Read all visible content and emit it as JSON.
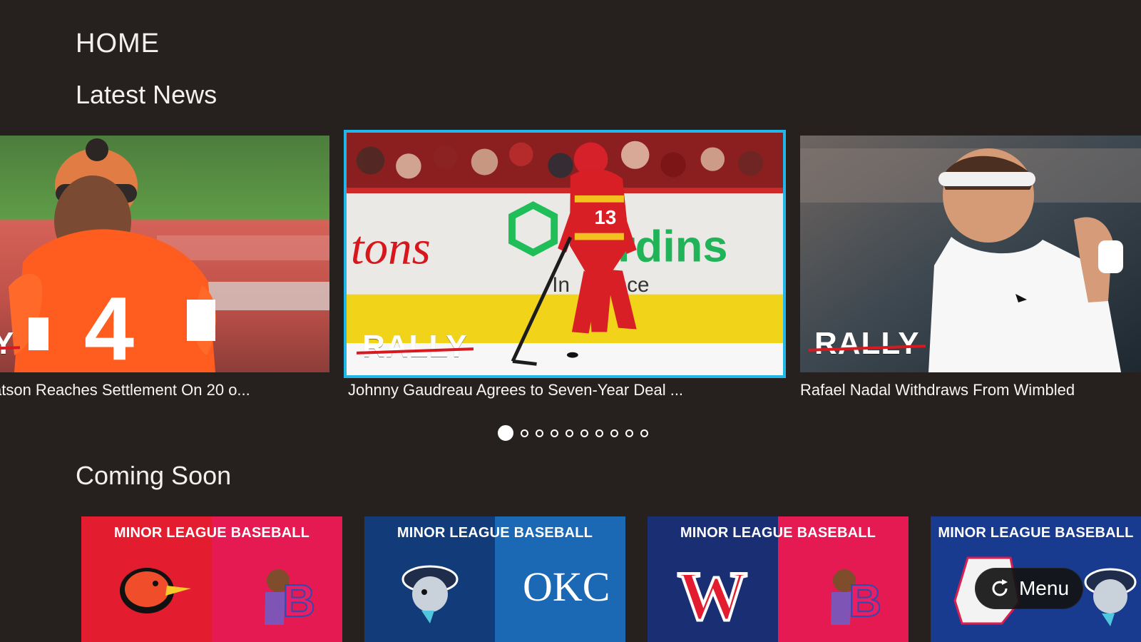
{
  "page": {
    "title": "HOME"
  },
  "sections": {
    "latest_news_title": "Latest News",
    "coming_soon_title": "Coming Soon"
  },
  "news": [
    {
      "caption": "atson Reaches Settlement On 20 o...",
      "badge": "Y"
    },
    {
      "caption": "Johnny Gaudreau Agrees to Seven-Year Deal ...",
      "badge": "RALLY"
    },
    {
      "caption": "Rafael Nadal Withdraws From Wimbled",
      "badge": "RALLY"
    }
  ],
  "carousel": {
    "total": 10,
    "active_index": 1
  },
  "coming_soon": [
    {
      "label": "MINOR LEAGUE BASEBALL"
    },
    {
      "label": "MINOR LEAGUE BASEBALL"
    },
    {
      "label": "MINOR LEAGUE BASEBALL"
    },
    {
      "label": "MINOR LEAGUE BASEBALL"
    }
  ],
  "menu": {
    "label": "Menu",
    "icon": "refresh-icon"
  },
  "colors": {
    "background": "#26211f",
    "focus": "#20b7e8",
    "rally_red": "#d71920",
    "orange": "#ff5a1f",
    "navy": "#10306d",
    "crimson": "#e11d48"
  }
}
